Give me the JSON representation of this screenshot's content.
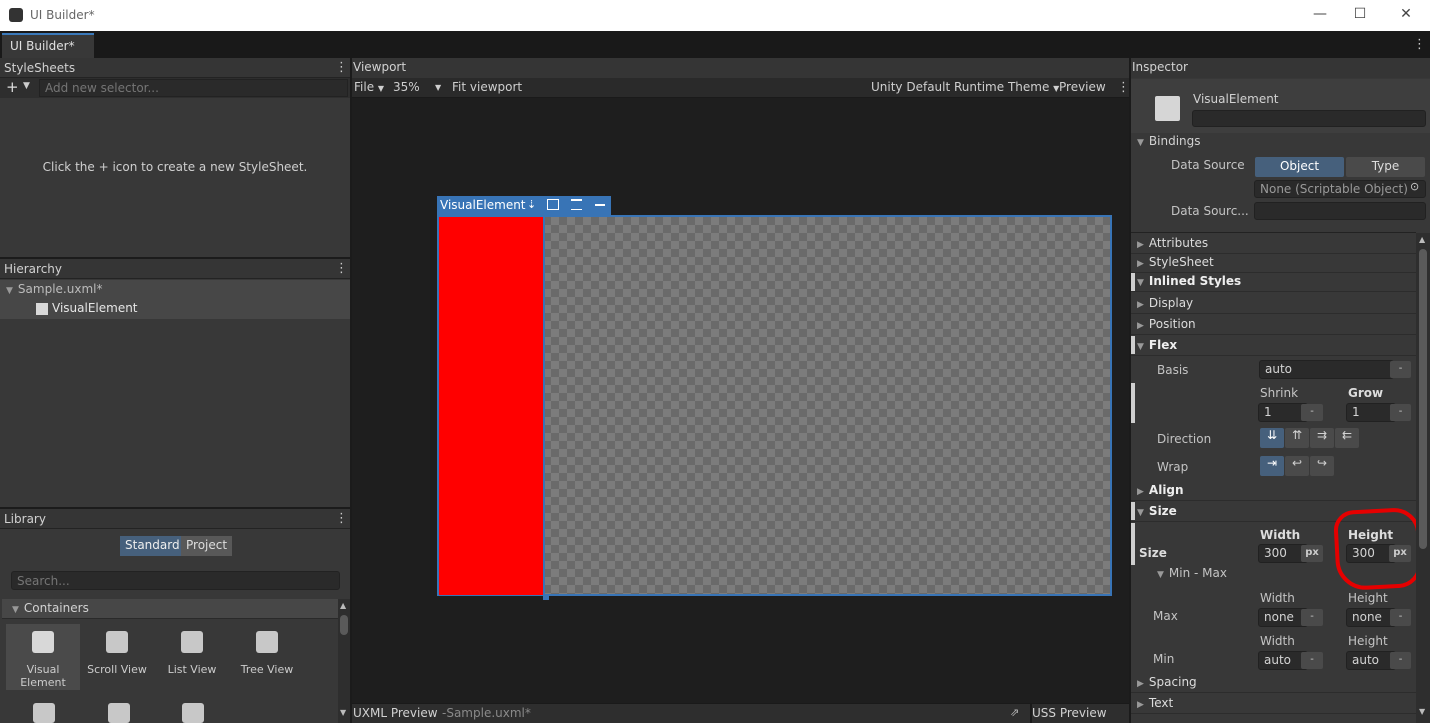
{
  "window": {
    "title": "UI Builder*",
    "tab": "UI Builder*",
    "minimize": "—",
    "maximize": "☐",
    "close": "✕"
  },
  "stylesheets": {
    "title": "StyleSheets",
    "add_label": "+",
    "placeholder": "Add new selector...",
    "empty_message": "Click the + icon to create a new StyleSheet."
  },
  "hierarchy": {
    "title": "Hierarchy",
    "root": "Sample.uxml*",
    "items": [
      "VisualElement"
    ]
  },
  "library": {
    "title": "Library",
    "tabs": [
      "Standard",
      "Project"
    ],
    "search_placeholder": "Search...",
    "section": "Containers",
    "items": [
      {
        "label": "Visual\nElement",
        "icon": "visual-element-icon"
      },
      {
        "label": "Scroll View",
        "icon": "scroll-view-icon"
      },
      {
        "label": "List View",
        "icon": "list-view-icon"
      },
      {
        "label": "Tree View",
        "icon": "tree-view-icon"
      }
    ]
  },
  "viewport": {
    "title": "Viewport",
    "file_label": "File",
    "zoom": "35%",
    "fit_label": "Fit viewport",
    "theme": "Unity Default Runtime Theme",
    "preview_label": "Preview",
    "element_label": "VisualElement"
  },
  "bottom": {
    "uxml_preview": "UXML Preview",
    "uxml_file": "-Sample.uxml*",
    "uss_preview": "USS Preview"
  },
  "inspector": {
    "title": "Inspector",
    "element_name": "VisualElement",
    "bindings": {
      "title": "Bindings",
      "data_source_label": "Data Source",
      "options": [
        "Object",
        "Type"
      ],
      "object_value": "None (Scriptable Object)",
      "path_label": "Data Sourc..."
    },
    "sections": {
      "attributes": "Attributes",
      "stylesheet": "StyleSheet",
      "inlined": "Inlined Styles",
      "display": "Display",
      "position": "Position",
      "flex": "Flex",
      "align": "Align",
      "size": "Size",
      "spacing": "Spacing",
      "text": "Text"
    },
    "flex": {
      "basis_label": "Basis",
      "basis": "auto",
      "shrink_label": "Shrink",
      "shrink": "1",
      "grow_label": "Grow",
      "grow": "1",
      "direction_label": "Direction",
      "wrap_label": "Wrap"
    },
    "size": {
      "label": "Size",
      "width_label": "Width",
      "width": "300",
      "height_label": "Height",
      "height": "300",
      "unit": "px",
      "minmax": "Min - Max",
      "max_label": "Max",
      "max_width": "none",
      "max_height": "none",
      "min_label": "Min",
      "min_width": "auto",
      "min_height": "auto"
    }
  },
  "colors": {
    "accent": "#3874b6",
    "element_fill": "#ff0000",
    "annotation": "#e60000"
  }
}
